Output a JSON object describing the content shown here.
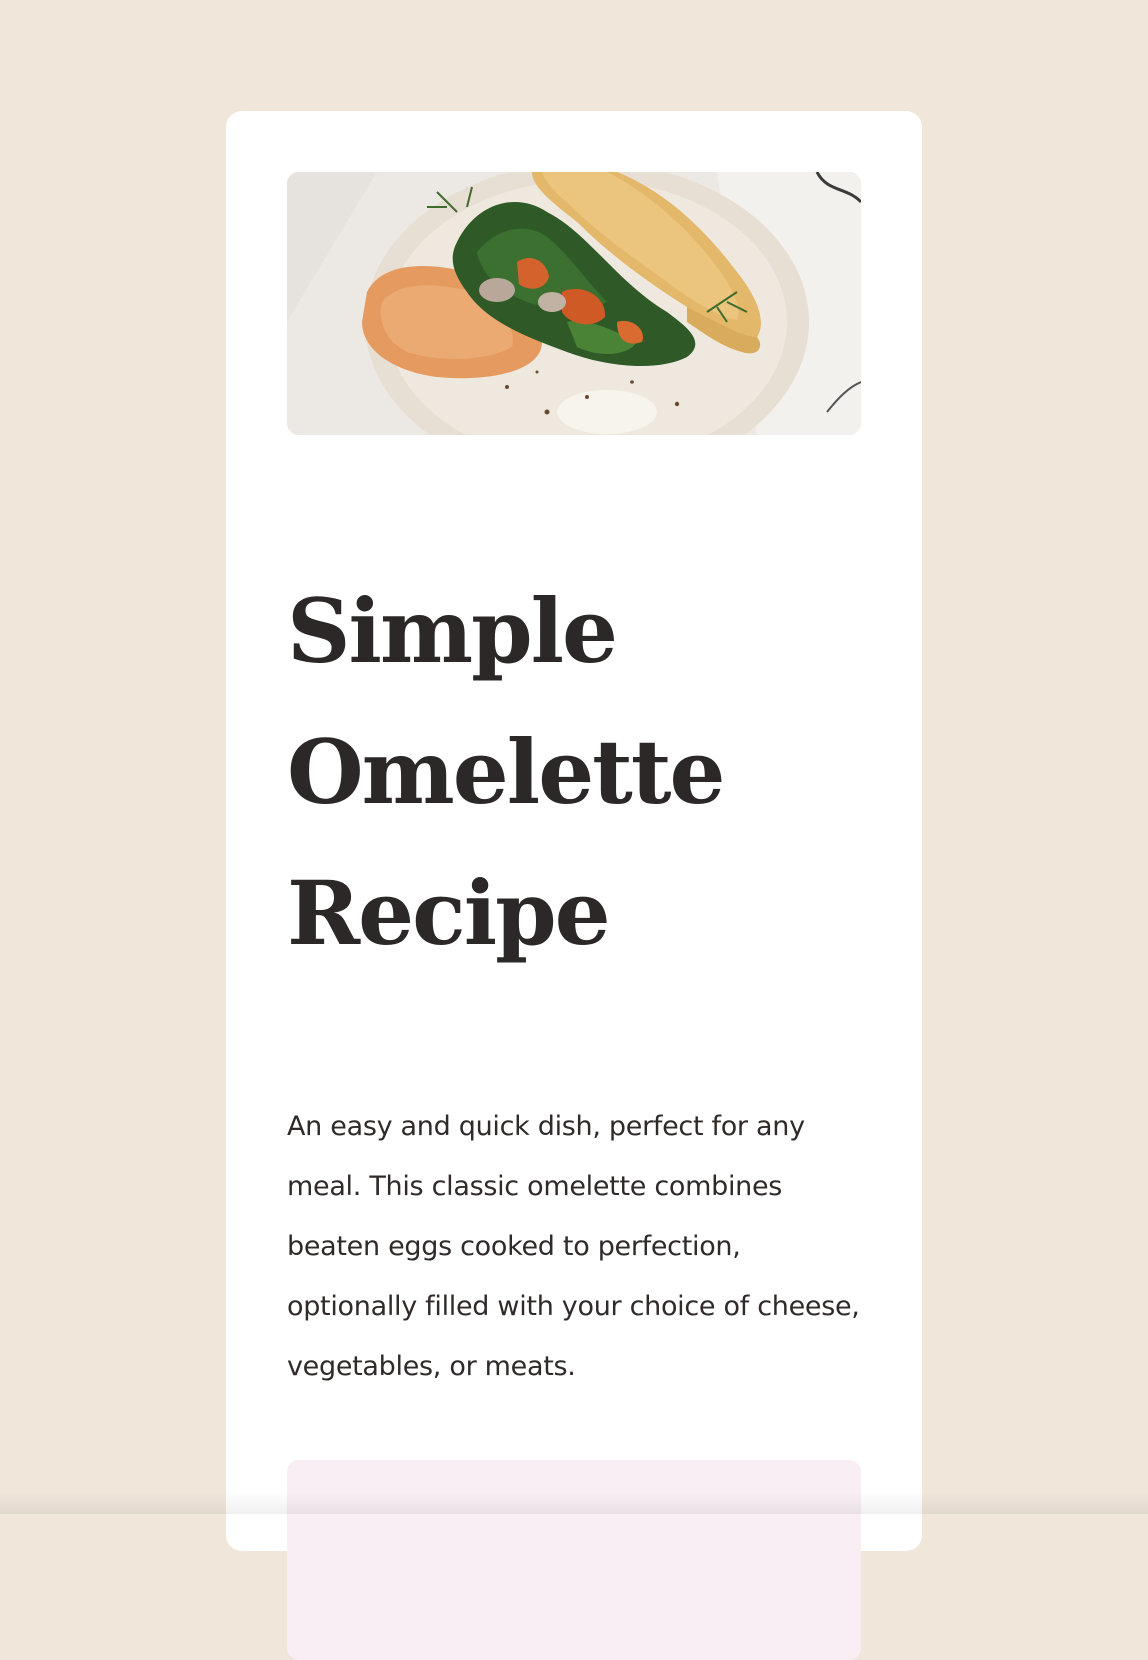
{
  "recipe": {
    "image_alt": "Omelette folded with spinach and vegetables on a speckled plate",
    "title_line1": "Simple",
    "title_line2": "Omelette",
    "title_line3": "Recipe",
    "description": "An easy and quick dish, perfect for any meal. This classic omelette combines beaten eggs cooked to perfection, optionally filled with your choice of cheese, vegetables, or meats."
  },
  "colors": {
    "page_background": "#f0e6da",
    "card_background": "#ffffff",
    "title_text": "#2c2827",
    "body_text": "#302b29",
    "prep_box_background": "#f8eef3"
  }
}
